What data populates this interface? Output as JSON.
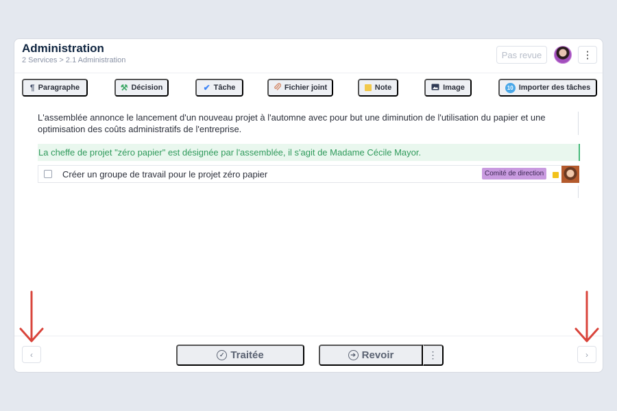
{
  "header": {
    "title": "Administration",
    "breadcrumb": "2 Services > 2.1 Administration",
    "status_button": "Pas revue",
    "more_label": "⋮"
  },
  "toolbar": {
    "items": [
      {
        "label": "Paragraphe",
        "icon": "paragraph-icon",
        "glyph": "¶",
        "color": "#4a5570"
      },
      {
        "label": "Décision",
        "icon": "gavel-icon",
        "glyph": "⚒",
        "color": "#3aa663"
      },
      {
        "label": "Tâche",
        "icon": "check-icon",
        "glyph": "✔",
        "color": "#3b82f6"
      },
      {
        "label": "Fichier joint",
        "icon": "paperclip-icon",
        "glyph": "📎",
        "color": "#d48a6a"
      },
      {
        "label": "Note",
        "icon": "sticky-note-icon",
        "glyph": "■",
        "color": "#f2c94c"
      },
      {
        "label": "Image",
        "icon": "image-icon",
        "glyph": "▣",
        "color": "#2e3a55"
      },
      {
        "label": "Importer des tâches",
        "icon": "import-badge-icon",
        "glyph": "10",
        "color": "#4aa8e8"
      }
    ]
  },
  "content": {
    "paragraph": "L'assemblée annonce le lancement d'un nouveau projet à l'automne avec pour but une diminution de l'utilisation du papier et une optimisation des coûts administratifs de l'entreprise.",
    "decision": "La cheffe de projet \"zéro papier\" est désignée par l'assemblée, il s'agit de Madame Cécile Mayor.",
    "task": {
      "text": "Créer un groupe de travail pour le projet zéro papier",
      "tag": "Comité de direction",
      "checked": false
    }
  },
  "footer": {
    "prev_label": "‹",
    "next_label": "›",
    "treated_label": "Traitée",
    "review_label": "Revoir",
    "more_label": "⋮"
  },
  "colors": {
    "decision_bg": "#e9f7ee",
    "decision_text": "#2f9a5b",
    "tag_bg": "#c99be0",
    "priority": "#f2c21b",
    "arrow": "#d9443b"
  }
}
